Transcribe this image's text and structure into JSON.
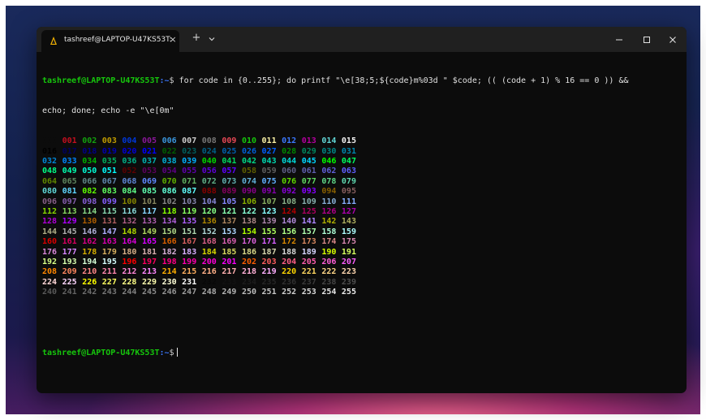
{
  "tab": {
    "title": "tashreef@LAPTOP-U47KS53T:",
    "close_glyph": "×",
    "new_tab_glyph": "+"
  },
  "terminal": {
    "prompt_user": "tashreef@LAPTOP-U47KS53T",
    "prompt_path": ":~",
    "prompt_symbol": "$",
    "command_line_1": " for code in {0..255}; do printf \"\\e[38;5;${code}m%03d \" $code; (( (code + 1) % 16 == 0 )) &&",
    "command_line_2": "echo; done; echo -e \"\\e[0m\"",
    "final_prompt_user": "tashreef@LAPTOP-U47KS53T",
    "final_prompt_path": ":~",
    "final_prompt_symbol": "$"
  },
  "colors": {
    "title_bar": "#202020",
    "terminal_bg": "#0c0c0c",
    "prompt_user": "#16c60c",
    "prompt_path": "#3b78ff"
  },
  "icons": {
    "tab_icon": "linux-penguin-icon",
    "dropdown": "chevron-down-icon",
    "minimize": "minimize-icon",
    "maximize": "maximize-icon",
    "close": "close-icon"
  },
  "color_grid": {
    "start": 0,
    "end": 255,
    "per_row": 16,
    "row_0_label_count": 16
  }
}
